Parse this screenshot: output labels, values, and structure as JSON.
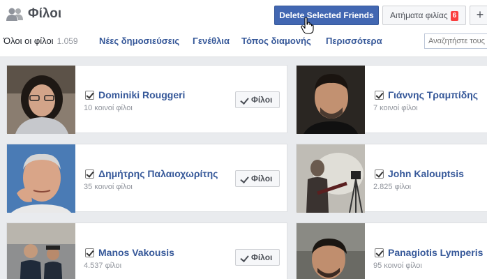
{
  "header": {
    "title": "Φίλοι",
    "delete_button": "Delete Selected Friends",
    "requests_button": "Αιτήματα φιλίας",
    "requests_badge": "6",
    "add_button": "+"
  },
  "tabs": [
    {
      "label": "Όλοι οι φίλοι",
      "count": "1.059"
    },
    {
      "label": "Νέες δημοσιεύσεις"
    },
    {
      "label": "Γενέθλια"
    },
    {
      "label": "Τόπος διαμονής"
    },
    {
      "label": "Περισσότερα"
    }
  ],
  "search": {
    "placeholder": "Αναζητήστε τους"
  },
  "friends": [
    {
      "name": "Dominiki Rouggeri",
      "mutual": "10 κοινοί φίλοι",
      "button": "Φίλοι"
    },
    {
      "name": "Γιάννης Τραμπίδης",
      "mutual": "7 κοινοί φίλοι"
    },
    {
      "name": "Δημήτρης Παλαιοχωρίτης",
      "mutual": "35 κοινοί φίλοι",
      "button": "Φίλοι"
    },
    {
      "name": "John Kalouptsis",
      "mutual": "2.825 φίλοι"
    },
    {
      "name": "Manos Vakousis",
      "mutual": "4.537 φίλοι",
      "button": "Φίλοι"
    },
    {
      "name": "Panagiotis Lymperis",
      "mutual": "95 κοινοί φίλοι"
    }
  ],
  "colors": {
    "accent": "#4267b2",
    "link": "#365899",
    "badge": "#fa3e3e"
  }
}
